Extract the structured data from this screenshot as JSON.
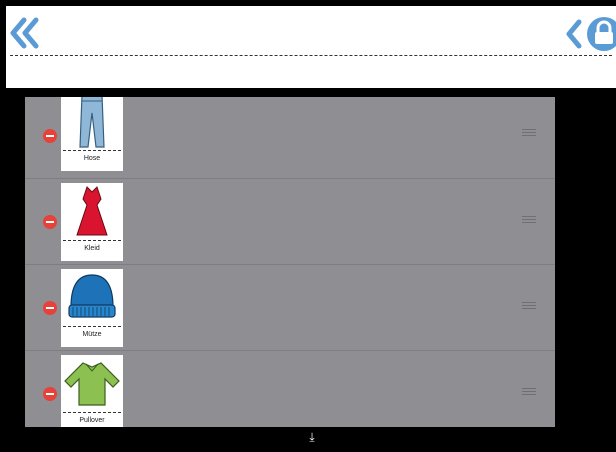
{
  "header": {
    "back_all_icon": "double-chevron-left-icon",
    "back_icon": "chevron-left-icon",
    "lock_icon": "lock-icon",
    "accent_color": "#5b9bd5"
  },
  "items": [
    {
      "label": "Hose",
      "icon": "trousers-icon"
    },
    {
      "label": "Kleid",
      "icon": "dress-icon"
    },
    {
      "label": "Mütze",
      "icon": "beanie-icon"
    },
    {
      "label": "Pullover",
      "icon": "sweater-icon"
    }
  ],
  "footer": {
    "icon": "download-arrow-icon",
    "glyph": "⤓"
  },
  "colors": {
    "list_bg": "#8e8e93",
    "remove": "#e8413a"
  }
}
